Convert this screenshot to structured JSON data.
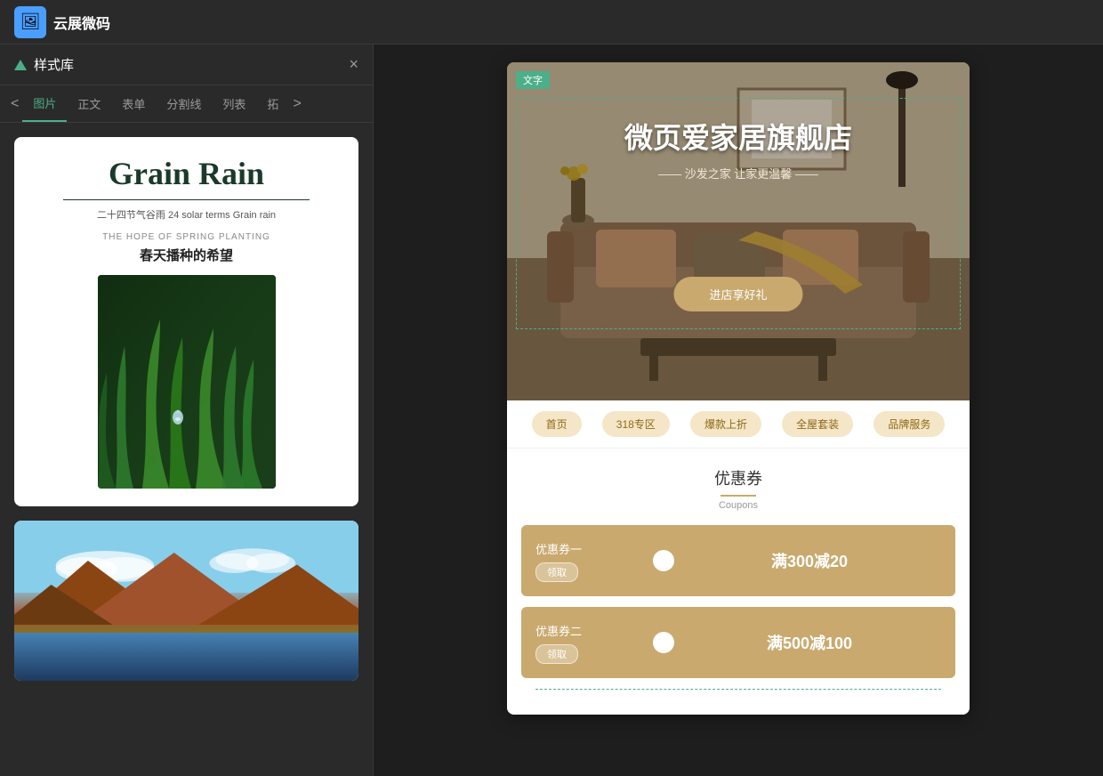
{
  "app": {
    "name": "云展微码",
    "logo_emoji": "🖼"
  },
  "left_panel": {
    "title": "样式库",
    "close_label": "×",
    "tabs": {
      "prev": "<",
      "next": ">",
      "items": [
        "图片",
        "正文",
        "表单",
        "分割线",
        "列表",
        "拓"
      ]
    },
    "active_tab": "图片"
  },
  "card1": {
    "title": "Grain Rain",
    "subtitle": "二十四节气谷雨 24  solar terms Grain rain",
    "hope_en": "THE HOPE OF SPRING PLANTING",
    "hope_cn": "春天播种的希望"
  },
  "preview": {
    "text_badge": "文字",
    "hero_title": "微页爱家居旗舰店",
    "hero_subtitle": "—— 沙发之家 让家更温馨 ——",
    "hero_btn": "进店享好礼",
    "nav_tabs": [
      "首页",
      "318专区",
      "爆款上折",
      "全屋套装",
      "品牌服务"
    ],
    "coupons_title": "优惠券",
    "coupons_sub": "Coupons",
    "coupon1": {
      "name": "优惠券一",
      "collect": "领取",
      "amount": "满300减20"
    },
    "coupon2": {
      "name": "优惠券二",
      "collect": "领取",
      "amount": "满500减100"
    }
  }
}
